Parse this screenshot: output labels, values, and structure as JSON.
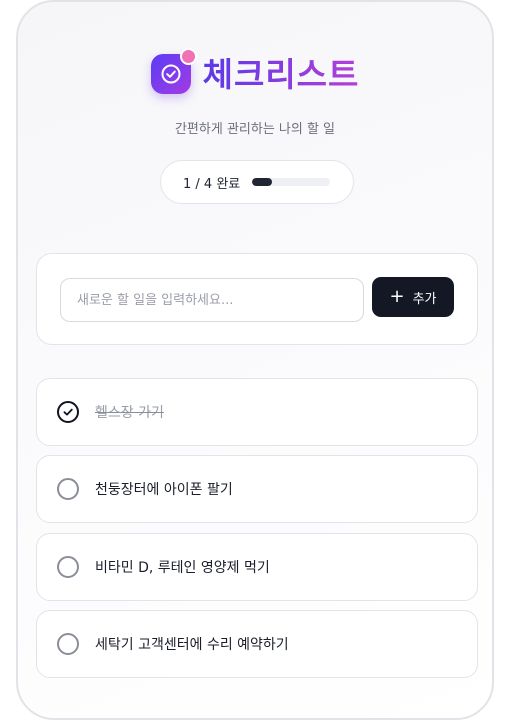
{
  "app": {
    "title": "체크리스트",
    "subtitle": "간편하게 관리하는 나의 할 일",
    "logo_icon": "check-circle-icon",
    "accent": "#5b3df5",
    "accent_secondary": "#a23be3",
    "badge_color": "#f072b4"
  },
  "progress": {
    "text": "1 / 4 완료",
    "completed": 1,
    "total": 4,
    "fraction": 0.25,
    "fill_color": "#222633"
  },
  "new_task": {
    "placeholder": "새로운 할 일을 입력하세요...",
    "value": "",
    "add_label": "추가",
    "add_icon": "plus-icon"
  },
  "tasks": [
    {
      "label": "헬스장 가기",
      "done": true
    },
    {
      "label": "천둥장터에 아이폰 팔기",
      "done": false
    },
    {
      "label": "비타민 D, 루테인 영양제 먹기",
      "done": false
    },
    {
      "label": "세탁기 고객센터에 수리 예약하기",
      "done": false
    }
  ]
}
